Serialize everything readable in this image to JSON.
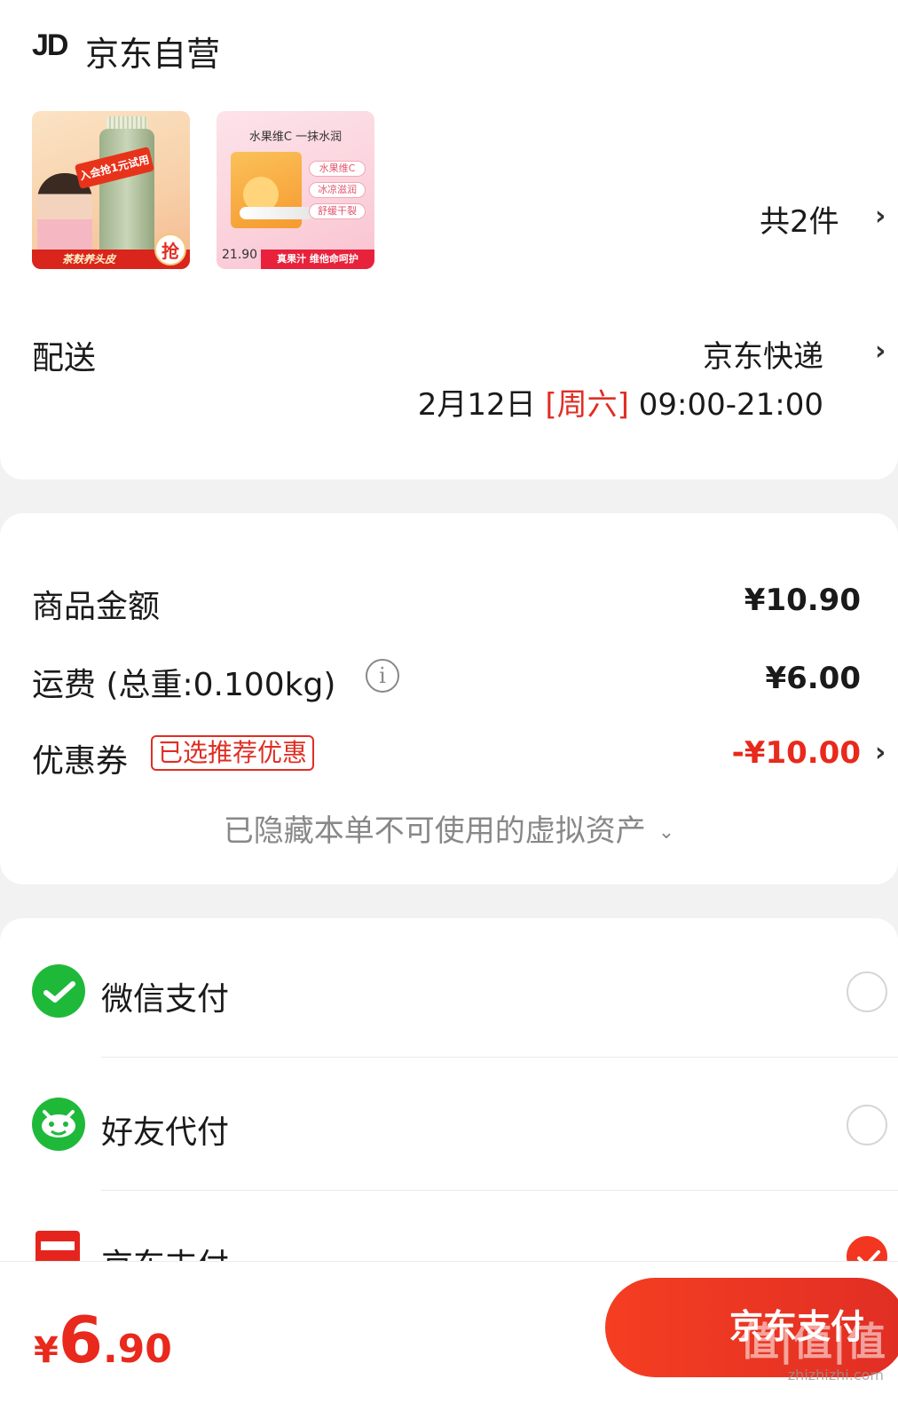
{
  "shop": {
    "logo": "JD",
    "name": "京东自营"
  },
  "products": {
    "item1": {
      "badge": "入会抢1元试用",
      "bottom_text": "茶麸养头皮",
      "grab": "抢"
    },
    "item2": {
      "title": "水果维C 一抹水润",
      "tags": [
        "水果维C",
        "冰凉滋润",
        "舒缓干裂"
      ],
      "price": "21.90",
      "bottom_text": "真果汁 维他命呵护"
    },
    "count": "共2件"
  },
  "delivery": {
    "label": "配送",
    "method": "京东快递",
    "date": "2月12日",
    "weekday": "[周六]",
    "time": "09:00-21:00"
  },
  "summary": {
    "goods_label": "商品金额",
    "goods_value": "¥10.90",
    "shipping_label": "运费 (总重:0.100kg)",
    "shipping_value": "¥6.00",
    "coupon_label": "优惠券",
    "coupon_tag": "已选推荐优惠",
    "coupon_value": "-¥10.00",
    "hidden_assets": "已隐藏本单不可使用的虚拟资产"
  },
  "payment": {
    "options": [
      {
        "label": "微信支付",
        "selected": false
      },
      {
        "label": "好友代付",
        "selected": false
      },
      {
        "label": "京东支付",
        "selected": true
      }
    ]
  },
  "bottom": {
    "total_currency": "¥",
    "total_int": "6",
    "total_dec": ".90",
    "submit_label": "京东支付",
    "watermark": "值|值|值",
    "watermark_site": "zhizhizhi.com"
  },
  "colors": {
    "accent": "#e02e24",
    "wechat": "#1fb93a",
    "jdpay": "#e5251d"
  }
}
